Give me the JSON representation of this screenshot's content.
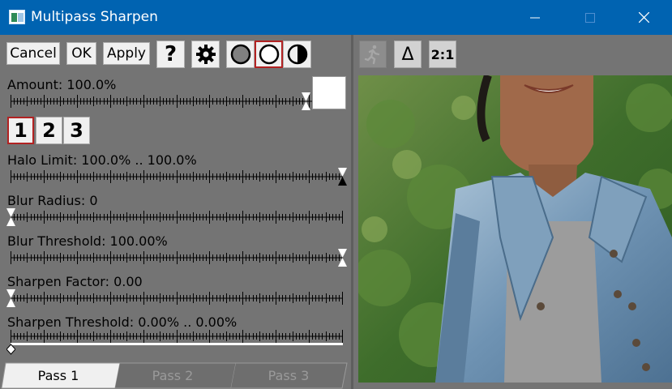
{
  "window": {
    "title": "Multipass Sharpen",
    "minimize_icon": "minimize-icon",
    "maximize_icon": "maximize-icon",
    "close_icon": "close-icon"
  },
  "toolbar": {
    "cancel_label": "Cancel",
    "ok_label": "OK",
    "apply_label": "Apply",
    "help_label": "?",
    "settings_icon": "gear-icon",
    "modes": [
      "circle-gray-icon",
      "circle-white-icon",
      "circle-half-icon"
    ],
    "selected_mode": 2
  },
  "amount": {
    "label": "Amount: 100.0%",
    "value": 1.0
  },
  "passes": {
    "buttons": [
      "1",
      "2",
      "3"
    ],
    "selected": 1
  },
  "sliders": {
    "halo_limit": {
      "label": "Halo Limit: 100.0% .. 100.0%",
      "low": 1.0,
      "high": 1.0
    },
    "blur_radius": {
      "label": "Blur Radius: 0",
      "value": 0
    },
    "blur_threshold": {
      "label": "Blur Threshold: 100.00%",
      "value": 1.0
    },
    "sharpen_factor": {
      "label": "Sharpen Factor: 0.00",
      "value": 0
    },
    "sharpen_threshold": {
      "label": "Sharpen Threshold: 0.00% .. 0.00%",
      "low": 0,
      "high": 0
    }
  },
  "tabs": [
    "Pass 1",
    "Pass 2",
    "Pass 3"
  ],
  "preview_toolbar": {
    "run_icon": "running-person-icon",
    "delta_label": "Δ",
    "zoom_label": "2:1"
  }
}
